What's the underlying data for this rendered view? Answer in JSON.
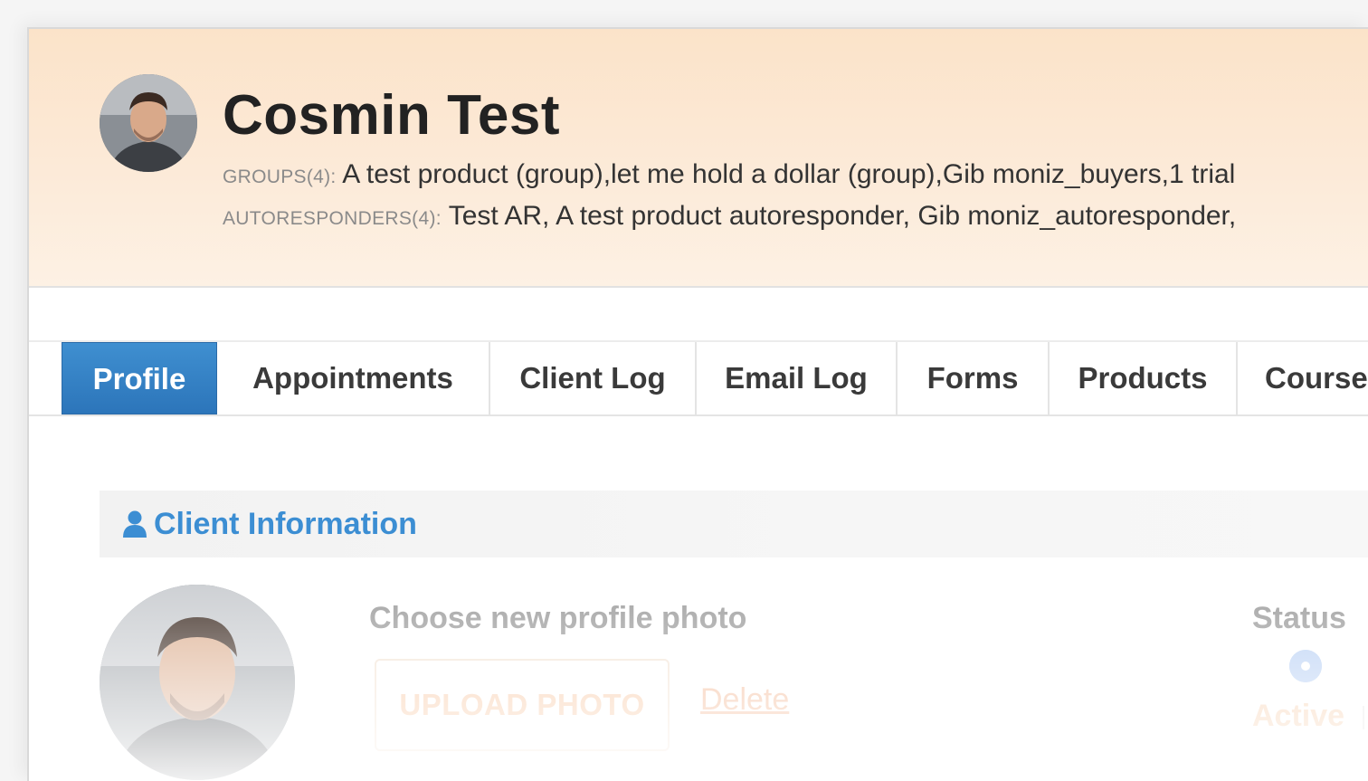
{
  "client": {
    "name": "Cosmin Test",
    "groups_label": "GROUPS(4):",
    "groups_value": "A test product (group),let me hold a dollar (group),Gib moniz_buyers,1 trial",
    "ars_label": "AUTORESPONDERS(4):",
    "ars_value": "Test AR, A test product autoresponder, Gib moniz_autoresponder,"
  },
  "tabs": [
    {
      "label": "Profile",
      "active": true
    },
    {
      "label": "Appointments"
    },
    {
      "label": "Client Log"
    },
    {
      "label": "Email Log"
    },
    {
      "label": "Forms"
    },
    {
      "label": "Products"
    },
    {
      "label": "Course"
    }
  ],
  "section": {
    "title": "Client Information",
    "icon": "user-icon"
  },
  "photo": {
    "choose_label": "Choose new profile photo",
    "upload_label": "UPLOAD PHOTO",
    "delete_label": "Delete"
  },
  "status": {
    "label": "Status",
    "active_label": "Active"
  },
  "colors": {
    "accent": "#2f7fc2",
    "header_bg": "#fbe6cf",
    "link": "#3c8ed3"
  }
}
